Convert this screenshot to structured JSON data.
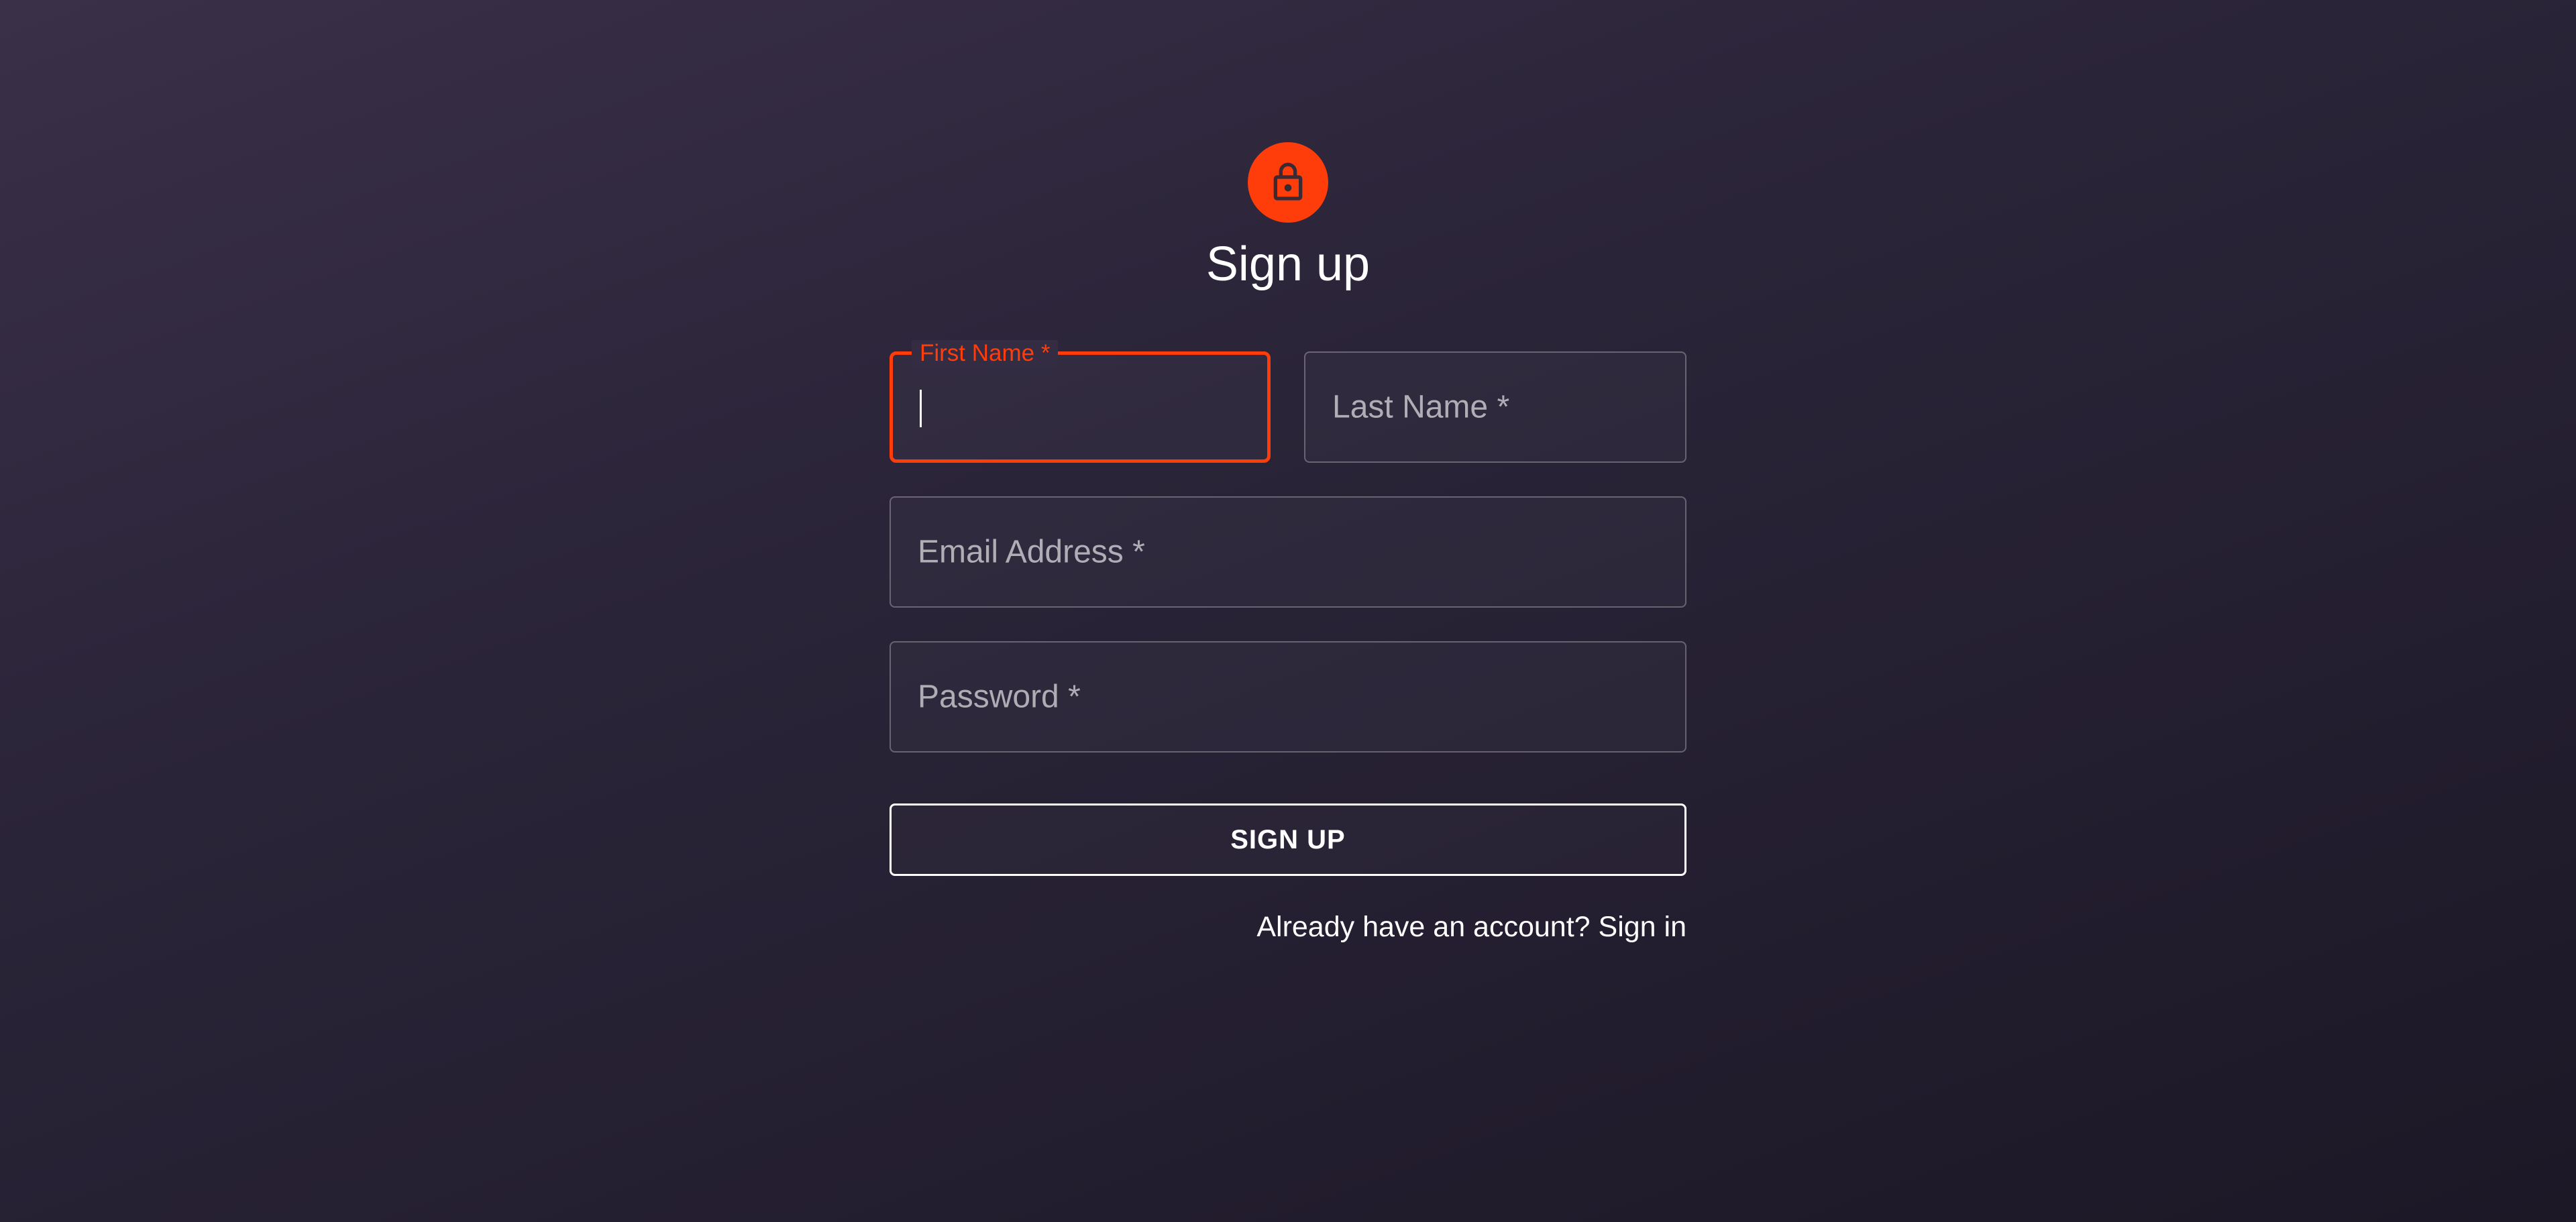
{
  "header": {
    "title": "Sign up",
    "icon": "lock-icon",
    "accent_color": "#ff3d0a"
  },
  "form": {
    "first_name": {
      "label": "First Name *",
      "value": ""
    },
    "last_name": {
      "label": "Last Name *",
      "value": ""
    },
    "email": {
      "label": "Email Address *",
      "value": ""
    },
    "password": {
      "label": "Password *",
      "value": ""
    },
    "submit_label": "SIGN UP",
    "signin_link": "Already have an account? Sign in"
  }
}
